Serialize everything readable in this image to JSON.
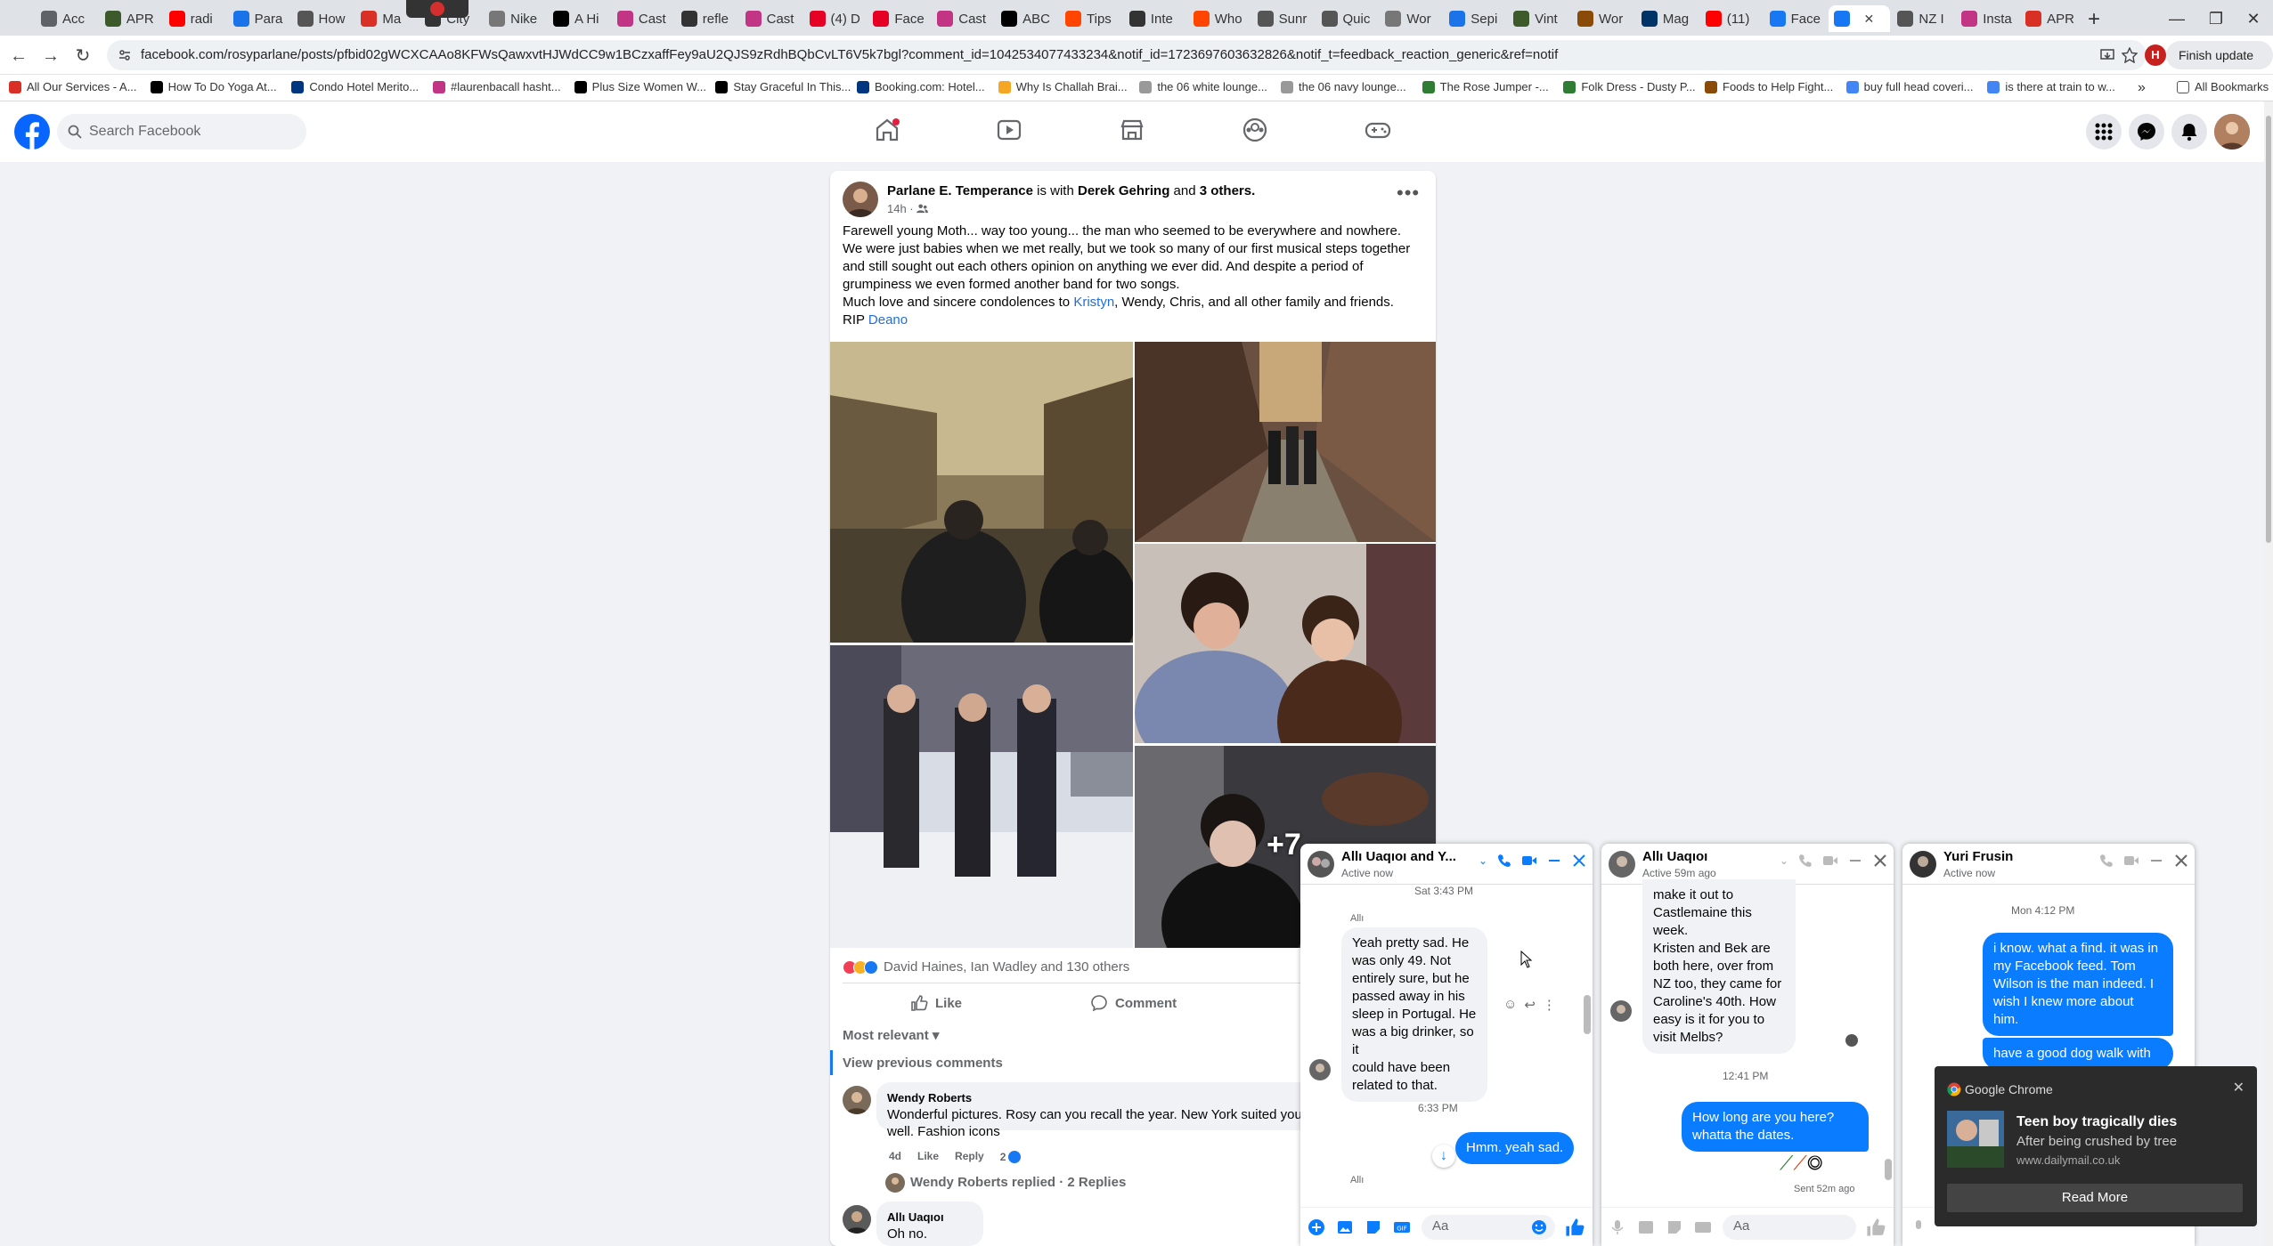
{
  "browser": {
    "tabs": [
      {
        "label": "Acc",
        "color": "#5f6368"
      },
      {
        "label": "APR",
        "color": "#3c5a2a"
      },
      {
        "label": "radi",
        "color": "#ff0000"
      },
      {
        "label": "Para",
        "color": "#1a73e8"
      },
      {
        "label": "How",
        "color": "#555"
      },
      {
        "label": "Ma",
        "color": "#d93025"
      },
      {
        "label": "City",
        "color": "#333"
      },
      {
        "label": "Nike",
        "color": "#777"
      },
      {
        "label": "A Hi",
        "color": "#000"
      },
      {
        "label": "Cast",
        "color": "#c13584"
      },
      {
        "label": "refle",
        "color": "#333"
      },
      {
        "label": "Cast",
        "color": "#c13584"
      },
      {
        "label": "(4) D",
        "color": "#e60023"
      },
      {
        "label": "Face",
        "color": "#e60023"
      },
      {
        "label": "Cast",
        "color": "#c13584"
      },
      {
        "label": "ABC",
        "color": "#000"
      },
      {
        "label": "Tips",
        "color": "#ff4500"
      },
      {
        "label": "Inte",
        "color": "#333"
      },
      {
        "label": "Who",
        "color": "#ff4500"
      },
      {
        "label": "Sunr",
        "color": "#555"
      },
      {
        "label": "Quic",
        "color": "#555"
      },
      {
        "label": "Wor",
        "color": "#777"
      },
      {
        "label": "Sepi",
        "color": "#1a73e8"
      },
      {
        "label": "Vint",
        "color": "#3c5a2a"
      },
      {
        "label": "Wor",
        "color": "#8a4b08"
      },
      {
        "label": "Mag",
        "color": "#003366"
      },
      {
        "label": "(11)",
        "color": "#ff0000"
      },
      {
        "label": "Face",
        "color": "#1877f2"
      },
      {
        "label": "",
        "color": "#1877f2",
        "active": true
      },
      {
        "label": "NZ I",
        "color": "#555"
      },
      {
        "label": "Insta",
        "color": "#c13584"
      },
      {
        "label": "APR",
        "color": "#d93025"
      }
    ],
    "url": "facebook.com/rosyparlane/posts/pfbid02gWCXCAAo8KFWsQawxvtHJWdCC9w1BCzxaffFey9aU2QJS9zRdhBQbCvLT6V5k7bgl?comment_id=1042534077433234&notif_id=1723697603632826&notif_t=feedback_reaction_generic&ref=notif",
    "finish_update": "Finish update",
    "profile_letter": "H",
    "bookmarks": [
      {
        "label": "All Our Services - A...",
        "color": "#d93025"
      },
      {
        "label": "How To Do Yoga At...",
        "color": "#000"
      },
      {
        "label": "Condo Hotel Merito...",
        "color": "#003580"
      },
      {
        "label": "#laurenbacall hasht...",
        "color": "#c13584"
      },
      {
        "label": "Plus Size Women W...",
        "color": "#000"
      },
      {
        "label": "Stay Graceful In This...",
        "color": "#000"
      },
      {
        "label": "Booking.com: Hotel...",
        "color": "#003580"
      },
      {
        "label": "Why Is Challah Brai...",
        "color": "#f5a623"
      },
      {
        "label": "the 06 white lounge...",
        "color": "#999"
      },
      {
        "label": "the 06 navy lounge...",
        "color": "#999"
      },
      {
        "label": "The Rose Jumper -...",
        "color": "#2e7d32"
      },
      {
        "label": "Folk Dress - Dusty P...",
        "color": "#2e7d32"
      },
      {
        "label": "Foods to Help Fight...",
        "color": "#8a4b08"
      },
      {
        "label": "buy full head coveri...",
        "color": "#4285f4"
      },
      {
        "label": "is there at train to w...",
        "color": "#4285f4"
      }
    ],
    "all_bookmarks": "All Bookmarks"
  },
  "fb": {
    "search_placeholder": "Search Facebook"
  },
  "post": {
    "author": "Parlane E. Temperance",
    "with_text": "is with",
    "with_name": "Derek Gehring",
    "and_text": "and",
    "others": "3 others.",
    "time": "14h ·",
    "body": [
      "Farewell young Moth... way too young... the man who seemed to be everywhere and nowhere.",
      "We were just babies when we met really, but we took so many of our first musical steps together",
      "and still sought out each others opinion on anything we ever did.   And despite a period of",
      "grumpiness we even formed another band for two songs."
    ],
    "line5_pre": "Much love and sincere condolences to",
    "line5_link": "Kristyn",
    "line5_post": ", Wendy, Chris, and all other family and friends.",
    "rip": "RIP",
    "rip_link": "Deano",
    "more_photos": "+7",
    "reactions_text": "David Haines, Ian Wadley and 130 others",
    "like": "Like",
    "comment": "Comment",
    "most_relevant": "Most relevant",
    "view_previous": "View previous comments",
    "comments": [
      {
        "name": "Wendy Roberts",
        "text1": "Wonderful pictures. Rosy can you recall the year. New York suited you",
        "text2": "well. Fashion icons",
        "age": "4d",
        "like": "Like",
        "reply": "Reply",
        "likes": "2"
      },
      {
        "replied": "Wendy Roberts replied · 2 Replies"
      },
      {
        "name": "Allı Uaqıoı",
        "text1": "Oh no."
      }
    ]
  },
  "chats": [
    {
      "name": "Allı Uaqıoı and Y...",
      "status": "Active now",
      "time_top": "Sat 3:43 PM",
      "sender": "Allı",
      "msg": [
        "Yeah pretty sad. He",
        "was only 49. Not",
        "entirely sure, but he",
        "passed away in his",
        "sleep in Portugal. He",
        "was a big drinker, so it",
        "could have been",
        "related to that."
      ],
      "time2": "6:33 PM",
      "out": "Hmm. yeah sad.",
      "sender2": "Allı",
      "input": "Aa"
    },
    {
      "name": "Allı Uaqıoı",
      "status": "Active 59m ago",
      "msg": [
        "make it out to",
        "Castlemaine this week.",
        "Kristen and Bek are",
        "both here, over from",
        "NZ too, they came for",
        "Caroline's 40th. How",
        "easy is it for you to",
        "visit Melbs?"
      ],
      "time2": "12:41 PM",
      "out": [
        "How long are you here?",
        "whatta the dates."
      ],
      "sent": "Sent 52m ago",
      "input": "Aa"
    },
    {
      "name": "Yuri Frusin",
      "status": "Active now",
      "time_top": "Mon 4:12 PM",
      "out": [
        "i know. what a find. it was in",
        "my Facebook feed. Tom",
        "Wilson is the man indeed. I",
        "wish I knew more about",
        "him."
      ],
      "out2": "have a good dog walk with"
    }
  ],
  "notification": {
    "app": "Google Chrome",
    "title": "Teen boy tragically dies",
    "message": "After being crushed by tree",
    "source": "www.dailymail.co.uk",
    "button": "Read More"
  }
}
